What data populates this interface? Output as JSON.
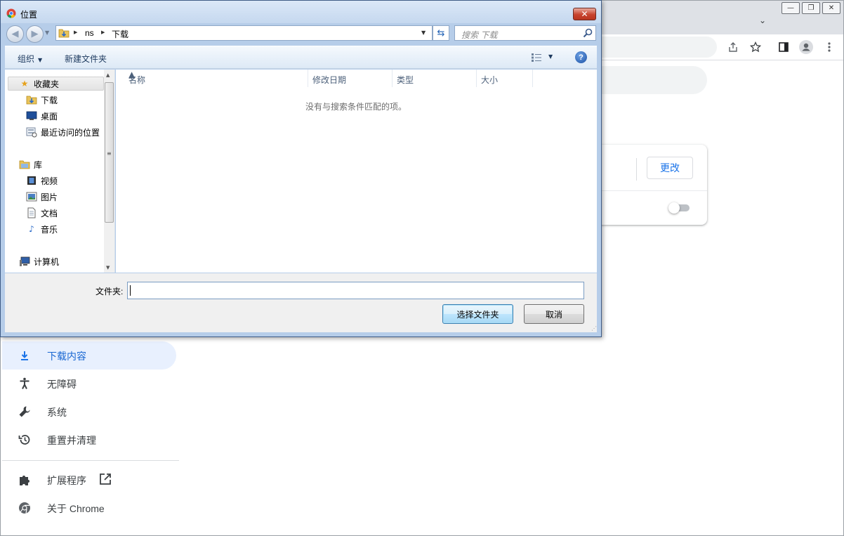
{
  "chrome": {
    "window_controls": {
      "minimize": "—",
      "restore": "❐",
      "close": "✕"
    },
    "tab_search": "⌄",
    "settings_card": {
      "change_button": "更改"
    },
    "nav": [
      {
        "label": "下载内容",
        "icon": "download-icon",
        "active": true
      },
      {
        "label": "无障碍",
        "icon": "accessibility-icon",
        "active": false
      },
      {
        "label": "系统",
        "icon": "wrench-icon",
        "active": false
      },
      {
        "label": "重置并清理",
        "icon": "restore-icon",
        "active": false
      },
      {
        "label": "扩展程序",
        "icon": "puzzle-icon",
        "active": false
      },
      {
        "label": "关于 Chrome",
        "icon": "chrome-icon",
        "active": false
      }
    ]
  },
  "dialog": {
    "title": "位置",
    "close": "✕",
    "breadcrumb": [
      "ns",
      "下载"
    ],
    "search_placeholder": "搜索 下载",
    "toolbar": {
      "organize": "组织",
      "new_folder": "新建文件夹",
      "help": "?"
    },
    "nav_pane": {
      "favorites": "收藏夹",
      "favorites_items": [
        "下载",
        "桌面",
        "最近访问的位置"
      ],
      "libraries": "库",
      "library_items": [
        "视频",
        "图片",
        "文档",
        "音乐"
      ],
      "computer": "计算机"
    },
    "columns": [
      "名称",
      "修改日期",
      "类型",
      "大小"
    ],
    "empty_message": "没有与搜索条件匹配的项。",
    "folder_label": "文件夹:",
    "folder_value": "",
    "buttons": {
      "select": "选择文件夹",
      "cancel": "取消"
    }
  },
  "colors": {
    "accent": "#1a73e8",
    "nav_active_bg": "#e8f0fe",
    "dialog_frame": "#b6cde9"
  }
}
